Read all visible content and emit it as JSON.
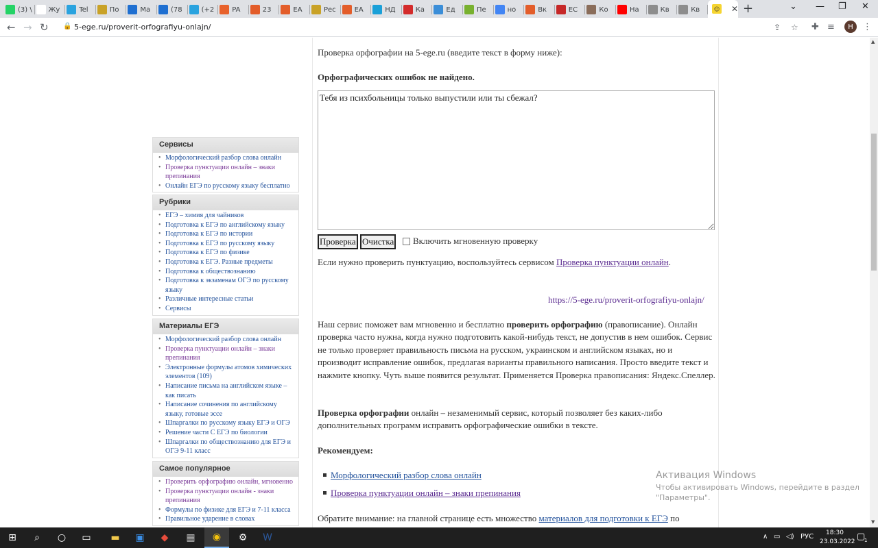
{
  "tabs": [
    {
      "label": "(3) \\",
      "icon": "whatsapp-icon",
      "color": "#25d366"
    },
    {
      "label": "Жу",
      "icon": "wiki-icon",
      "color": "#ffffff"
    },
    {
      "label": "Tel",
      "icon": "telegram-icon",
      "color": "#2aa3df"
    },
    {
      "label": "По",
      "icon": "emblem-icon",
      "color": "#c9a227"
    },
    {
      "label": "Ma",
      "icon": "mail-icon",
      "color": "#1f6fd1"
    },
    {
      "label": "(78",
      "icon": "inbox-icon",
      "color": "#1f6fd1"
    },
    {
      "label": "(+2",
      "icon": "chat-icon",
      "color": "#2aa3df"
    },
    {
      "label": "PA",
      "icon": "red-circle-icon",
      "color": "#e8622c"
    },
    {
      "label": "23",
      "icon": "doc-icon",
      "color": "#e35d2a"
    },
    {
      "label": "ЕА",
      "icon": "doc-icon",
      "color": "#e35d2a"
    },
    {
      "label": "Рес",
      "icon": "emblem-icon",
      "color": "#c9a227"
    },
    {
      "label": "ЕА",
      "icon": "doc-icon",
      "color": "#e35d2a"
    },
    {
      "label": "НД",
      "icon": "nd-icon",
      "color": "#1aa0d8"
    },
    {
      "label": "Ка",
      "icon": "letter-d-icon",
      "color": "#d32b2b"
    },
    {
      "label": "Ед",
      "icon": "k-icon",
      "color": "#3b8ed8"
    },
    {
      "label": "Пе",
      "icon": "grid-icon",
      "color": "#78b12f"
    },
    {
      "label": "но",
      "icon": "google-icon",
      "color": "#4285f4"
    },
    {
      "label": "Вк",
      "icon": "doc-icon",
      "color": "#e35d2a"
    },
    {
      "label": "ЕС",
      "icon": "shield-icon",
      "color": "#c62828"
    },
    {
      "label": "Ко",
      "icon": "photo-icon",
      "color": "#8a6d5a"
    },
    {
      "label": "На",
      "icon": "youtube-icon",
      "color": "#ff0000"
    },
    {
      "label": "Кв",
      "icon": "house-icon",
      "color": "#8d8d8d"
    },
    {
      "label": "Кв",
      "icon": "house-icon",
      "color": "#8d8d8d"
    }
  ],
  "address": {
    "url": "5-ege.ru/proverit-orfografiyu-onlajn/"
  },
  "avatar_letter": "Н",
  "sidebar": [
    {
      "title": "Сервисы",
      "items": [
        "Морфологический разбор слова онлайн",
        "Проверка пунктуации онлайн – знаки препинания",
        "Онлайн ЕГЭ по русскому языку бесплатно"
      ],
      "visited": [
        1
      ]
    },
    {
      "title": "Рубрики",
      "items": [
        "ЕГЭ – химия для чайников",
        "Подготовка к ЕГЭ по английскому языку",
        "Подготовка к ЕГЭ по истории",
        "Подготовка к ЕГЭ по русскому языку",
        "Подготовка к ЕГЭ по физике",
        "Подготовка к ЕГЭ. Разные предметы",
        "Подготовка к обществознанию",
        "Подготовка к экзаменам ОГЭ по русскому языку",
        "Различные интересные статьи",
        "Сервисы"
      ],
      "visited": []
    },
    {
      "title": "Материалы ЕГЭ",
      "items": [
        "Морфологический разбор слова онлайн",
        "Проверка пунктуации онлайн – знаки препинания",
        "Электронные формулы атомов химических элементов (109)",
        "Написание письма на английском языке – как писать",
        "Написание сочинения по английскому языку, готовые эссе",
        "Шпаргалки по русскому языку ЕГЭ и ОГЭ",
        "Решение части С ЕГЭ по биологии",
        "Шпаргалки по обществознанию для ЕГЭ и ОГЭ 9-11 класс"
      ],
      "visited": [
        1
      ]
    },
    {
      "title": "Самое популярное",
      "items": [
        "Проверить орфографию онлайн, мгновенно",
        "Проверка пунктуации онлайн - знаки препинания",
        "Формулы по физике для ЕГЭ и 7-11 класса",
        "Правильное ударение в словах"
      ],
      "visited": [
        0,
        1
      ]
    }
  ],
  "main": {
    "intro": "Проверка орфографии на 5-ege.ru (введите текст в форму ниже):",
    "result": "Орфографических ошибок не найдено.",
    "textarea_value": "Тебя из психбольницы только выпустили или ты сбежал?",
    "check_btn": "Проверка",
    "clear_btn": "Очистка",
    "instant_label": "Включить мгновенную проверку",
    "punct_pre": "Если нужно проверить пунктуацию, воспользуйтесь сервисом ",
    "punct_link": "Проверка пунктуации онлайн",
    "punct_post": ".",
    "page_url": "https://5-ege.ru/proverit-orfografiyu-onlajn/",
    "p1_pre": "Наш сервис поможет вам мгновенно и бесплатно ",
    "p1_bold": "проверить орфографию",
    "p1_post": " (правописание). Онлайн проверка часто нужна, когда нужно подготовить какой-нибудь текст, не допустив в нем ошибок. Сервис не только проверяет правильность письма на русском, украинском и английском языках, но и производит исправление ошибок, предлагая варианты правильного написания. Просто введите текст и нажмите кнопку. Чуть выше появится результат. Применяется Проверка правописания: Яндекс.Спеллер.",
    "p2_bold": "Проверка орфографии",
    "p2_post": " онлайн – незаменимый сервис, который позволяет без каких-либо дополнительных программ исправить орфографические ошибки в тексте.",
    "recommend": "Рекомендуем:",
    "rec_items": [
      "Морфологический разбор слова онлайн",
      "Проверка пунктуации онлайн – знаки препинания"
    ],
    "note_pre": "Обратите внимание: на главной странице есть множество ",
    "note_link": "материалов для подготовки к ЕГЭ",
    "note_post": " по"
  },
  "watermark": {
    "line1": "Активация Windows",
    "line2": "Чтобы активировать Windows, перейдите в раздел",
    "line3": "\"Параметры\"."
  },
  "taskbar": {
    "lang": "РУС",
    "time": "18:30",
    "date": "23.03.2022",
    "notif_count": "1"
  }
}
